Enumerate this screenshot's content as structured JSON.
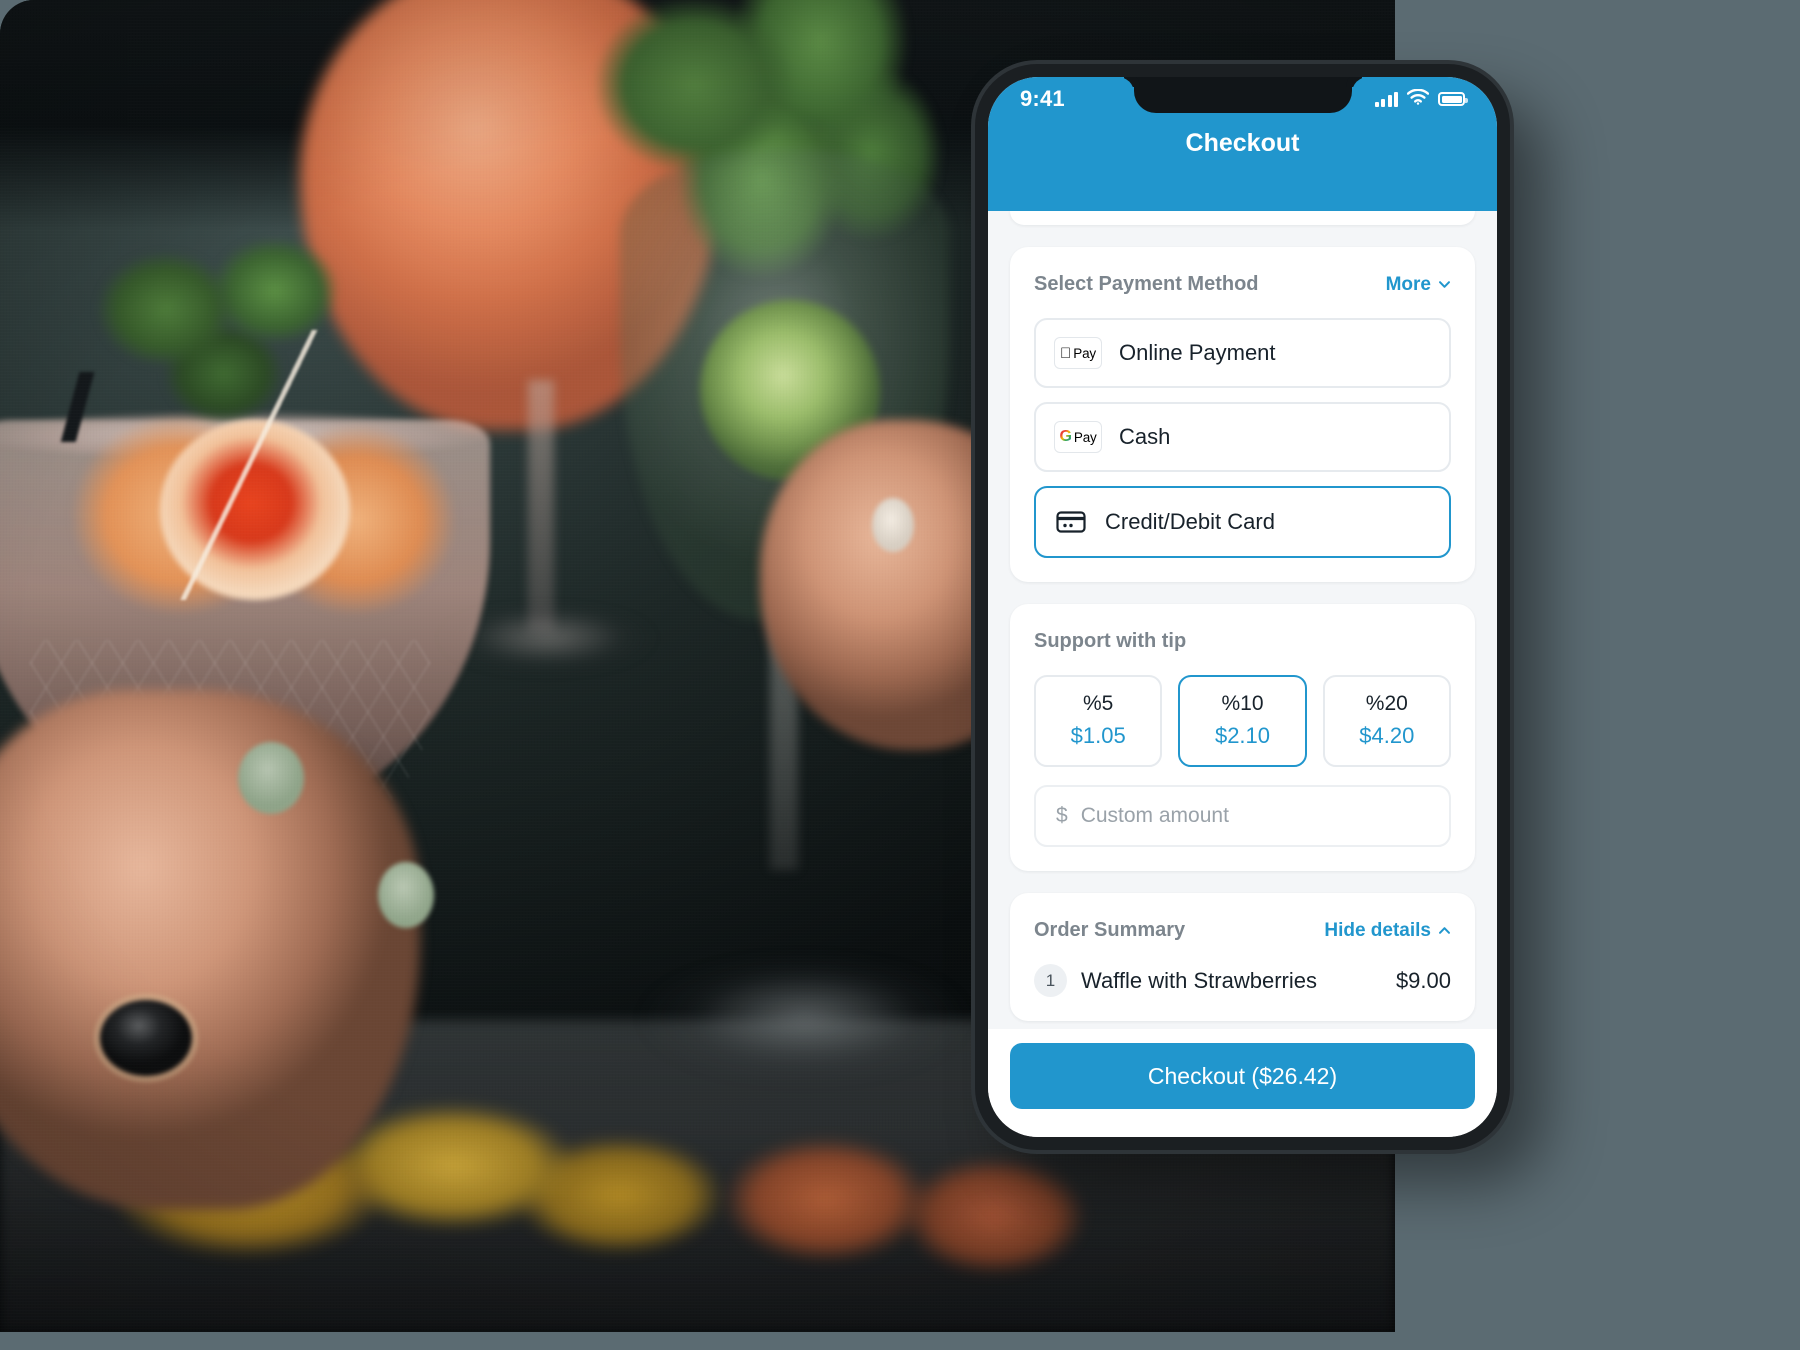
{
  "status_bar": {
    "time": "9:41",
    "signal_icon": "signal-bars-icon",
    "wifi_icon": "wifi-icon",
    "battery_icon": "battery-icon"
  },
  "header": {
    "title": "Checkout"
  },
  "payment_section": {
    "title": "Select Payment Method",
    "more_label": "More",
    "more_chevron": "chevron-down-icon",
    "options": [
      {
        "label": "Online Payment",
        "icon": "apple-pay-icon",
        "badge_mark": "",
        "badge_text": "Pay",
        "selected": false
      },
      {
        "label": "Cash",
        "icon": "google-pay-icon",
        "badge_mark": "G",
        "badge_text": "Pay",
        "selected": false
      },
      {
        "label": "Credit/Debit Card",
        "icon": "credit-card-icon",
        "selected": true
      }
    ]
  },
  "tip_section": {
    "title": "Support with tip",
    "options": [
      {
        "percent": "%5",
        "amount": "$1.05",
        "selected": false
      },
      {
        "percent": "%10",
        "amount": "$2.10",
        "selected": true
      },
      {
        "percent": "%20",
        "amount": "$4.20",
        "selected": false
      }
    ],
    "custom": {
      "currency_symbol": "$",
      "placeholder": "Custom amount",
      "value": ""
    }
  },
  "order_summary": {
    "title": "Order Summary",
    "toggle_label": "Hide details",
    "toggle_chevron": "chevron-up-icon",
    "items": [
      {
        "qty": "1",
        "name": "Waffle with Strawberries",
        "price": "$9.00"
      }
    ]
  },
  "footer": {
    "checkout_label": "Checkout ($26.42)"
  },
  "theme": {
    "accent": "#2196cd",
    "screen_bg": "#f4f6f8",
    "card_bg": "#ffffff",
    "muted_text": "#7c858d",
    "body_text": "#18222b",
    "border": "#e6eaee",
    "canvas_bg": "#5b6b72"
  }
}
